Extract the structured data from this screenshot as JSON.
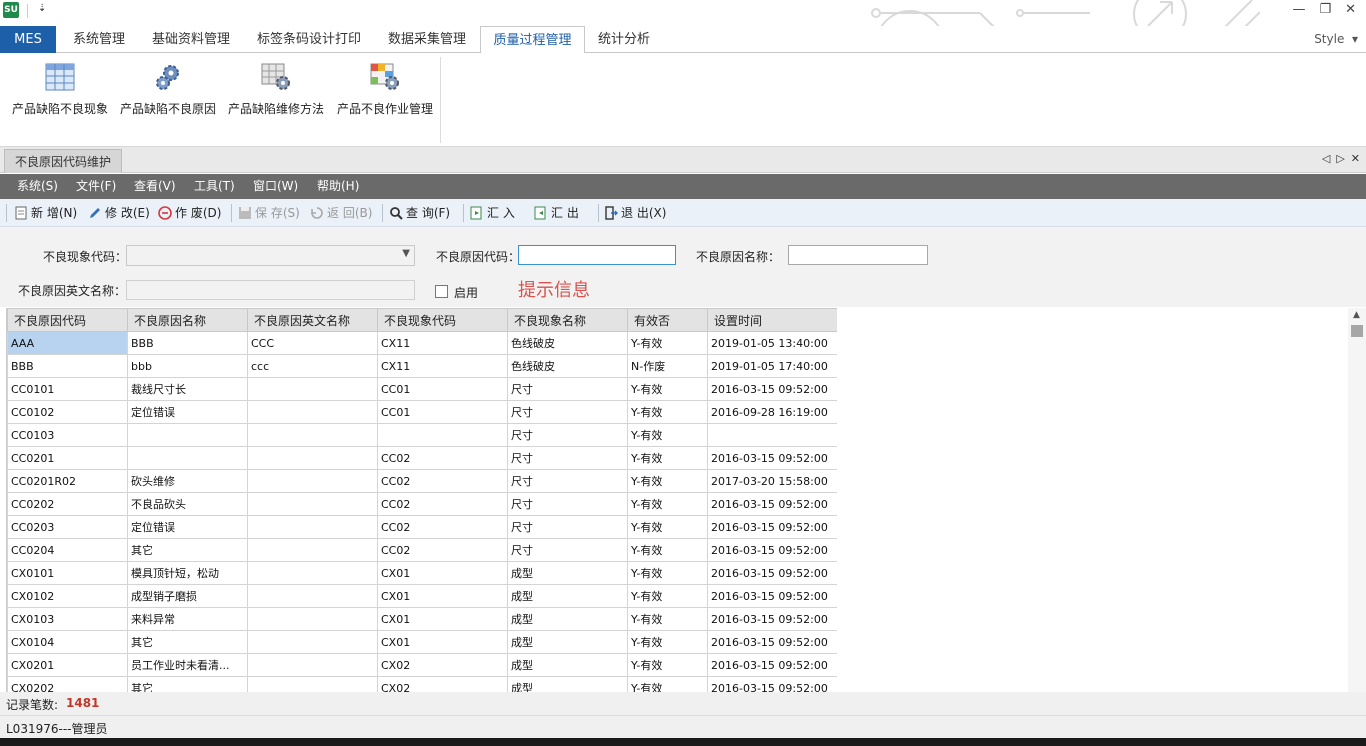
{
  "app": {
    "logo": "SU",
    "qat_icon": "⇣",
    "style_menu": "Style"
  },
  "window": {
    "min": "—",
    "restore": "❐",
    "close": "✕"
  },
  "tabs": [
    "MES",
    "系统管理",
    "基础资料管理",
    "标签条码设计打印",
    "数据采集管理",
    "质量过程管理",
    "统计分析"
  ],
  "ribbon": {
    "buttons": [
      {
        "label": "产品缺陷不良现象",
        "icon": "table-grid-icon"
      },
      {
        "label": "产品缺陷不良原因",
        "icon": "gears-icon"
      },
      {
        "label": "产品缺陷维修方法",
        "icon": "table-gear-icon"
      },
      {
        "label": "产品不良作业管理",
        "icon": "colored-table-gear-icon"
      }
    ]
  },
  "doc_tab": {
    "title": "不良原因代码维护"
  },
  "menubar": [
    "系统(S)",
    "文件(F)",
    "查看(V)",
    "工具(T)",
    "窗口(W)",
    "帮助(H)"
  ],
  "toolbar": {
    "new": "新 增(N)",
    "edit": "修 改(E)",
    "void": "作 废(D)",
    "save": "保 存(S)",
    "back": "返 回(B)",
    "query": "查 询(F)",
    "import": "汇 入",
    "export": "汇 出",
    "exit": "退 出(X)"
  },
  "form": {
    "phenomenon_code_label": "不良现象代码：",
    "reason_code_label": "不良原因代码：",
    "reason_name_label": "不良原因名称：",
    "reason_en_label": "不良原因英文名称：",
    "enabled_label": "启用",
    "hint": "提示信息"
  },
  "grid": {
    "columns": [
      "不良原因代码",
      "不良原因名称",
      "不良原因英文名称",
      "不良现象代码",
      "不良现象名称",
      "有效否",
      "设置时间"
    ],
    "rows": [
      [
        "AAA",
        "BBB",
        "CCC",
        "CX11",
        "色线破皮",
        "Y-有效",
        "2019-01-05 13:40:00"
      ],
      [
        "BBB",
        "bbb",
        "ccc",
        "CX11",
        "色线破皮",
        "N-作废",
        "2019-01-05 17:40:00"
      ],
      [
        "CC0101",
        "裁线尺寸长",
        "",
        "CC01",
        "尺寸",
        "Y-有效",
        "2016-03-15 09:52:00"
      ],
      [
        "CC0102",
        "定位错误",
        "",
        "CC01",
        "尺寸",
        "Y-有效",
        "2016-09-28 16:19:00"
      ],
      [
        "CC0103",
        "",
        "",
        "",
        "尺寸",
        "Y-有效",
        ""
      ],
      [
        "CC0201",
        "",
        "",
        "CC02",
        "尺寸",
        "Y-有效",
        "2016-03-15 09:52:00"
      ],
      [
        "CC0201R02",
        "砍头维修",
        "",
        "CC02",
        "尺寸",
        "Y-有效",
        "2017-03-20 15:58:00"
      ],
      [
        "CC0202",
        "不良品砍头",
        "",
        "CC02",
        "尺寸",
        "Y-有效",
        "2016-03-15 09:52:00"
      ],
      [
        "CC0203",
        "定位错误",
        "",
        "CC02",
        "尺寸",
        "Y-有效",
        "2016-03-15 09:52:00"
      ],
      [
        "CC0204",
        "其它",
        "",
        "CC02",
        "尺寸",
        "Y-有效",
        "2016-03-15 09:52:00"
      ],
      [
        "CX0101",
        "模具顶针短，松动",
        "",
        "CX01",
        "成型",
        "Y-有效",
        "2016-03-15 09:52:00"
      ],
      [
        "CX0102",
        "成型销子磨损",
        "",
        "CX01",
        "成型",
        "Y-有效",
        "2016-03-15 09:52:00"
      ],
      [
        "CX0103",
        "来料异常",
        "",
        "CX01",
        "成型",
        "Y-有效",
        "2016-03-15 09:52:00"
      ],
      [
        "CX0104",
        "其它",
        "",
        "CX01",
        "成型",
        "Y-有效",
        "2016-03-15 09:52:00"
      ],
      [
        "CX0201",
        "员工作业时未看清...",
        "",
        "CX02",
        "成型",
        "Y-有效",
        "2016-03-15 09:52:00"
      ],
      [
        "CX0202",
        "其它",
        "",
        "CX02",
        "成型",
        "Y-有效",
        "2016-03-15 09:52:00"
      ]
    ]
  },
  "status": {
    "record_label": "记录笔数:",
    "record_count": "1481",
    "user": "L031976---管理员"
  },
  "colors": {
    "accent": "#1d5fa8",
    "hint": "#d9534f",
    "count": "#c0392b",
    "selected": "#b7d3f0"
  }
}
